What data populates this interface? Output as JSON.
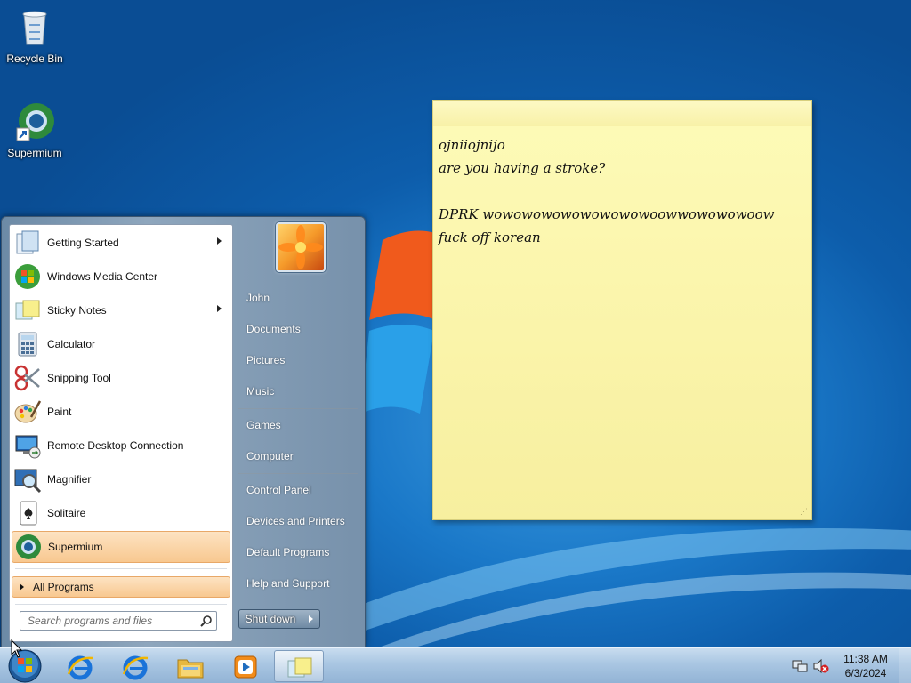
{
  "desktop": {
    "icons": [
      {
        "label": "Recycle Bin",
        "icon": "recycle-bin-icon"
      },
      {
        "label": "Supermium",
        "icon": "supermium-icon"
      }
    ]
  },
  "sticky_note": {
    "text": "ojniiojnijo\nare you having a stroke?\n\nDPRK wowowowowowowowowoowwowowowoow fuck off korean"
  },
  "start_menu": {
    "left_items": [
      {
        "label": "Getting Started",
        "icon": "getting-started-icon",
        "has_submenu": true
      },
      {
        "label": "Windows Media Center",
        "icon": "media-center-icon",
        "has_submenu": false
      },
      {
        "label": "Sticky Notes",
        "icon": "sticky-notes-icon",
        "has_submenu": true
      },
      {
        "label": "Calculator",
        "icon": "calculator-icon",
        "has_submenu": false
      },
      {
        "label": "Snipping Tool",
        "icon": "scissors-icon",
        "has_submenu": false
      },
      {
        "label": "Paint",
        "icon": "paint-palette-icon",
        "has_submenu": false
      },
      {
        "label": "Remote Desktop Connection",
        "icon": "remote-desktop-icon",
        "has_submenu": false
      },
      {
        "label": "Magnifier",
        "icon": "magnifier-icon",
        "has_submenu": false
      },
      {
        "label": "Solitaire",
        "icon": "playing-card-icon",
        "has_submenu": false
      },
      {
        "label": "Supermium",
        "icon": "supermium-icon",
        "has_submenu": false,
        "highlighted": true
      }
    ],
    "all_programs": "All Programs",
    "search": {
      "placeholder": "Search programs and files",
      "value": ""
    },
    "right_items": [
      "John",
      "Documents",
      "Pictures",
      "Music",
      "Games",
      "Computer",
      "Control Panel",
      "Devices and Printers",
      "Default Programs",
      "Help and Support"
    ],
    "shutdown_label": "Shut down"
  },
  "taskbar": {
    "pinned": [
      "internet-explorer-icon",
      "internet-explorer-icon",
      "file-explorer-icon",
      "media-player-icon",
      "sticky-notes-icon"
    ],
    "tray": [
      "network-icon",
      "volume-muted-icon"
    ],
    "time": "11:38 AM",
    "date": "6/3/2024"
  },
  "colors": {
    "desktop_blue": "#1a78c8",
    "sticky_yellow": "#fcf7b0",
    "highlight_orange": "#f8c890",
    "taskbar": "#a9c6e2"
  }
}
